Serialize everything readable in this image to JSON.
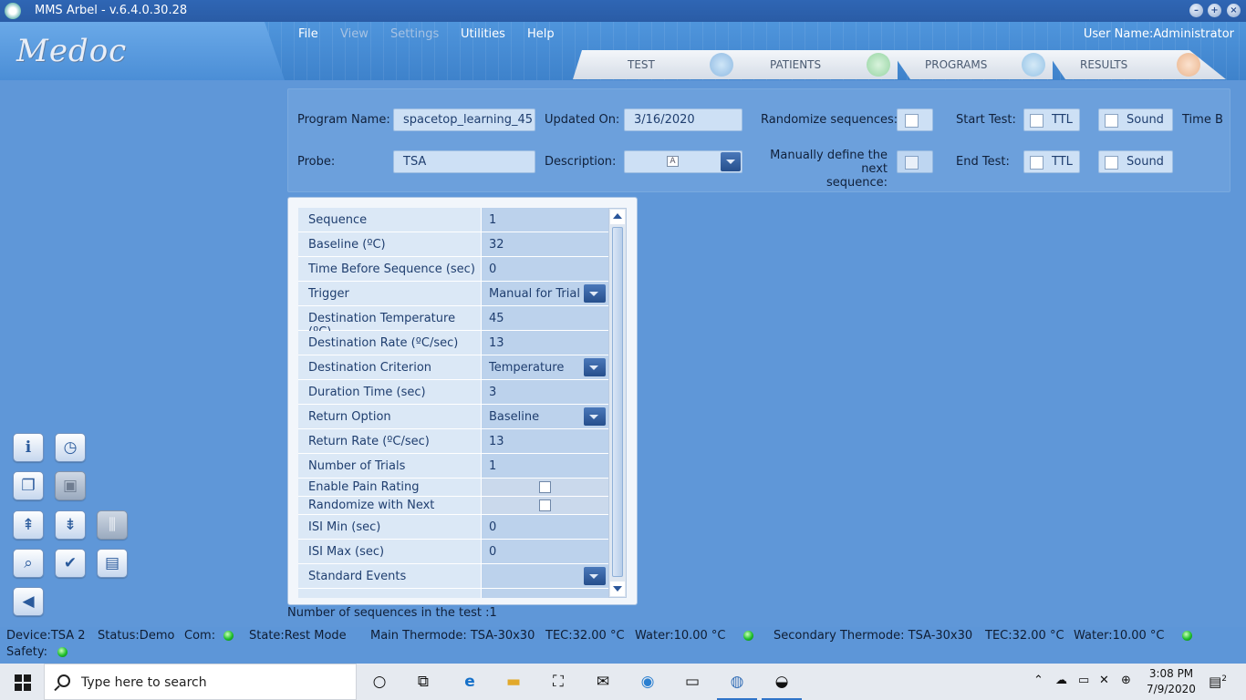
{
  "window": {
    "title": "MMS Arbel - v.6.4.0.30.28"
  },
  "header": {
    "logo": "Medoc",
    "menu": [
      {
        "label": "File",
        "enabled": true
      },
      {
        "label": "View",
        "enabled": false
      },
      {
        "label": "Settings",
        "enabled": false
      },
      {
        "label": "Utilities",
        "enabled": true
      },
      {
        "label": "Help",
        "enabled": true
      }
    ],
    "user": "User Name:Administrator",
    "tabs": [
      {
        "label": "TEST",
        "icon": "waveform-icon"
      },
      {
        "label": "PATIENTS",
        "icon": "patient-icon"
      },
      {
        "label": "PROGRAMS",
        "icon": "programs-icon"
      },
      {
        "label": "RESULTS",
        "icon": "results-icon"
      }
    ]
  },
  "program": {
    "name_label": "Program Name:",
    "name_value": "spacetop_learning_45",
    "updated_label": "Updated On:",
    "updated_value": "3/16/2020",
    "randomize_label": "Randomize sequences:",
    "start_label": "Start Test:",
    "end_label": "End Test:",
    "ttl_label": "TTL",
    "sound_label": "Sound",
    "time_b_label": "Time B",
    "probe_label": "Probe:",
    "probe_value": "TSA",
    "description_label": "Description:",
    "manual_label_1": "Manually define the next",
    "manual_label_2": "sequence:"
  },
  "sequence_rows": [
    {
      "label": "Sequence",
      "value": "1"
    },
    {
      "label": "Baseline (ºC)",
      "value": "32"
    },
    {
      "label": "Time Before Sequence (sec)",
      "value": "0"
    },
    {
      "label": "Trigger",
      "value": "Manual for Trial"
    },
    {
      "label": "Destination Temperature (ºC)",
      "value": "45"
    },
    {
      "label": "Destination Rate (ºC/sec)",
      "value": "13"
    },
    {
      "label": "Destination Criterion",
      "value": "Temperature"
    },
    {
      "label": "Duration Time (sec)",
      "value": "3"
    },
    {
      "label": "Return Option",
      "value": "Baseline"
    },
    {
      "label": "Return Rate (ºC/sec)",
      "value": "13"
    },
    {
      "label": "Number of Trials",
      "value": "1"
    },
    {
      "label": "Enable Pain Rating",
      "value": ""
    },
    {
      "label": "Randomize with Next",
      "value": ""
    },
    {
      "label": "ISI Min (sec)",
      "value": "0"
    },
    {
      "label": "ISI Max (sec)",
      "value": "0"
    },
    {
      "label": "Standard Events",
      "value": ""
    }
  ],
  "sequence_count": "Number of sequences in the test :1",
  "status": {
    "device": "Device:TSA 2",
    "status": "Status:Demo",
    "com": "Com:",
    "state": "State:Rest Mode",
    "main_thermode": "Main Thermode: TSA-30x30",
    "main_tec": "TEC:32.00 °C",
    "main_water": "Water:10.00 °C",
    "secondary_thermode": "Secondary Thermode: TSA-30x30",
    "secondary_tec": "TEC:32.00 °C",
    "secondary_water": "Water:10.00 °C",
    "safety": "Safety:"
  },
  "taskbar": {
    "search_placeholder": "Type here to search",
    "time": "3:08 PM",
    "date": "7/9/2020",
    "notification_count": "2"
  },
  "colors": {
    "accent": "#2f66b4",
    "panel": "#5f97d8",
    "led": "#1fbf2c"
  }
}
